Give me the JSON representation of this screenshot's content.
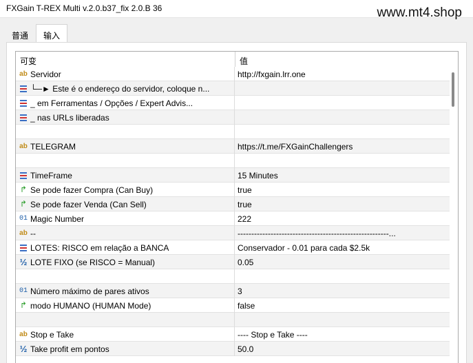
{
  "window": {
    "title": "FXGain T-REX Multi v.2.0.b37_fix 2.0.B 36",
    "watermark": "www.mt4.shop"
  },
  "tabs": [
    {
      "label": "普通",
      "active": false
    },
    {
      "label": "输入",
      "active": true
    }
  ],
  "table": {
    "col_variable": "可变",
    "col_value": "值",
    "rows": [
      {
        "icon": "ab",
        "label": "Servidor",
        "value": "http://fxgain.lrr.one"
      },
      {
        "icon": "list",
        "label": "└─► Este é o endereço do servidor, coloque n...",
        "value": ""
      },
      {
        "icon": "list",
        "label": "_          em Ferramentas / Opções / Expert Advis...",
        "value": ""
      },
      {
        "icon": "list",
        "label": "_          nas URLs liberadas",
        "value": ""
      },
      {
        "icon": "",
        "label": "",
        "value": ""
      },
      {
        "icon": "ab",
        "label": "TELEGRAM",
        "value": "https://t.me/FXGainChallengers"
      },
      {
        "icon": "",
        "label": "",
        "value": ""
      },
      {
        "icon": "list",
        "label": "TimeFrame",
        "value": "15 Minutes"
      },
      {
        "icon": "arrow",
        "label": "Se pode fazer Compra (Can Buy)",
        "value": "true"
      },
      {
        "icon": "arrow",
        "label": "Se pode fazer Venda (Can Sell)",
        "value": "true"
      },
      {
        "icon": "num",
        "label": "Magic Number",
        "value": "222"
      },
      {
        "icon": "ab",
        "label": "--",
        "value": "-------------------------------------------------------..."
      },
      {
        "icon": "list",
        "label": "LOTES: RISCO em relação a BANCA",
        "value": "Conservador - 0.01 para cada $2.5k"
      },
      {
        "icon": "half",
        "label": "LOTE FIXO (se RISCO = Manual)",
        "value": "0.05"
      },
      {
        "icon": "",
        "label": "",
        "value": ""
      },
      {
        "icon": "num",
        "label": "Número máximo de pares ativos",
        "value": "3"
      },
      {
        "icon": "arrow",
        "label": "modo HUMANO (HUMAN Mode)",
        "value": "false"
      },
      {
        "icon": "",
        "label": "",
        "value": ""
      },
      {
        "icon": "ab",
        "label": "Stop e Take",
        "value": "---- Stop e Take ----"
      },
      {
        "icon": "half",
        "label": "Take profit em pontos",
        "value": "50.0"
      }
    ]
  },
  "icon_glyphs": {
    "ab": "ab",
    "num": "01",
    "half": "½",
    "arrow": "↱"
  },
  "colors": {
    "ab_icon": "#c08a16",
    "num_icon": "#1e5ea8",
    "arrow_icon": "#2a9d2a",
    "list_icon_blue": "#3a6fc4",
    "list_icon_red": "#d03030"
  }
}
